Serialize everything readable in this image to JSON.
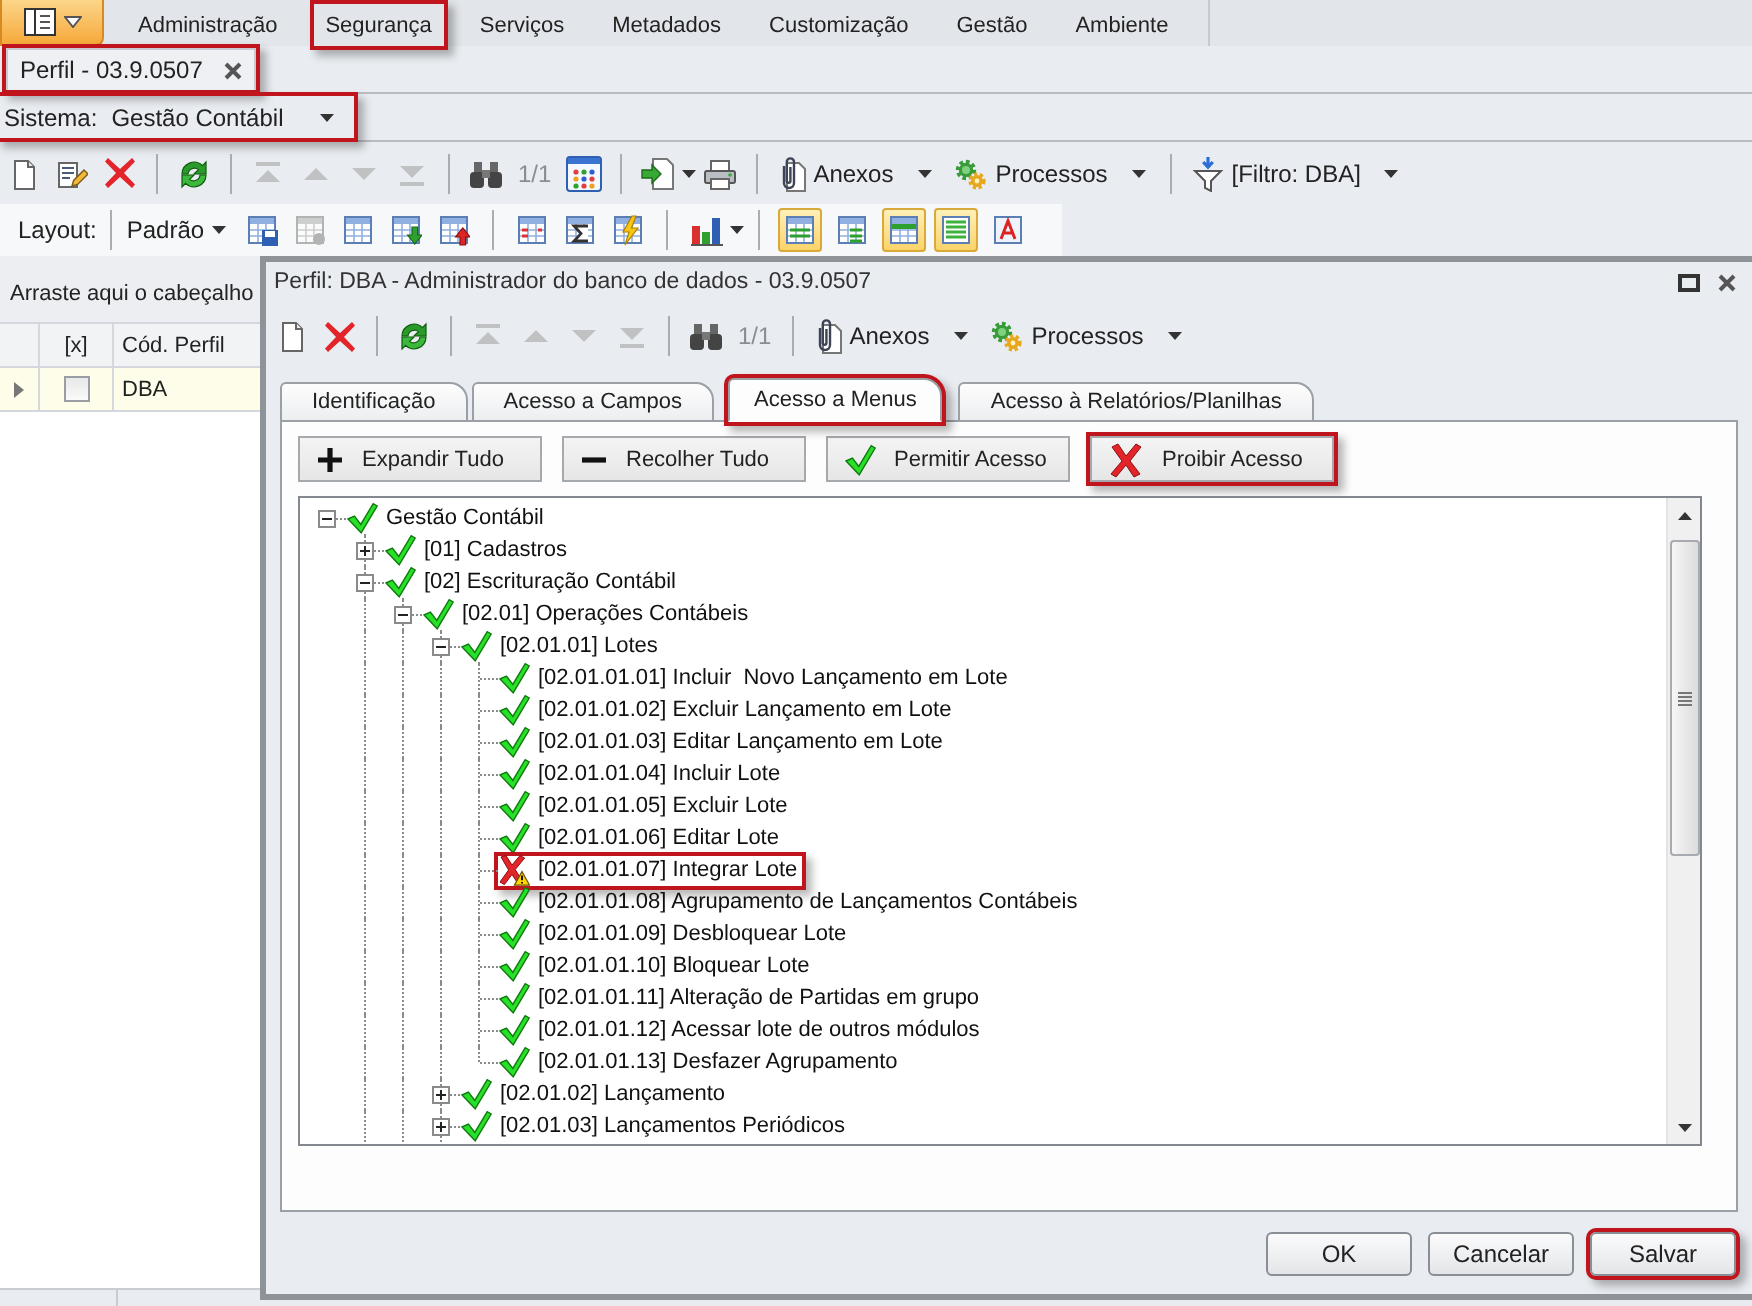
{
  "menu_bar": {
    "items": [
      {
        "label": "Administração",
        "highlighted": false
      },
      {
        "label": "Segurança",
        "highlighted": true
      },
      {
        "label": "Serviços",
        "highlighted": false
      },
      {
        "label": "Metadados",
        "highlighted": false
      },
      {
        "label": "Customização",
        "highlighted": false
      },
      {
        "label": "Gestão",
        "highlighted": false
      },
      {
        "label": "Ambiente",
        "highlighted": false
      }
    ]
  },
  "document_tabs": [
    {
      "label": "Perfil - 03.9.0507",
      "selected": true,
      "highlighted": true
    }
  ],
  "system_selector": {
    "label": "Sistema:",
    "value": "Gestão Contábil",
    "highlighted": true
  },
  "main_toolbar": {
    "navigation": [
      {
        "disabled": true
      },
      {
        "disabled": true
      },
      {
        "disabled": true
      },
      {
        "disabled": true
      }
    ],
    "record_counter": "1/1",
    "attachments": "Anexos",
    "processes": "Processos",
    "filter": "[Filtro: DBA]"
  },
  "layout_toolbar": {
    "label": "Layout:",
    "preset": "Padrão",
    "grid_buttons": [
      {
        "disabled": false
      },
      {
        "disabled": true
      },
      {
        "disabled": false
      },
      {
        "disabled": false
      },
      {
        "disabled": false
      }
    ],
    "view_buttons": [
      {
        "on": true
      },
      {
        "on": false
      },
      {
        "on": true
      },
      {
        "on": true
      },
      {
        "on": false
      }
    ]
  },
  "grid": {
    "group_panel_hint": "Arraste aqui o cabeçalho",
    "columns": [
      "[x]",
      "Cód. Perfil"
    ],
    "rows": [
      {
        "selected": true,
        "checked": false,
        "cells": [
          "",
          "DBA"
        ]
      }
    ]
  },
  "dialog": {
    "title": "Perfil: DBA - Administrador do banco de dados - 03.9.0507",
    "toolbar": {
      "navigation": [
        {
          "disabled": true
        },
        {
          "disabled": true
        },
        {
          "disabled": true
        },
        {
          "disabled": true
        }
      ],
      "record_counter": "1/1",
      "attachments": "Anexos",
      "processes": "Processos"
    },
    "tabs": [
      {
        "label": "Identificação",
        "selected": false,
        "highlighted": false
      },
      {
        "label": "Acesso a Campos",
        "selected": false,
        "highlighted": false
      },
      {
        "label": "Acesso a Menus",
        "selected": true,
        "highlighted": true
      },
      {
        "label": "Acesso à Relatórios/Planilhas",
        "selected": false,
        "highlighted": false
      }
    ],
    "actions": [
      {
        "label": "Expandir Tudo",
        "kind": "expand",
        "highlighted": false
      },
      {
        "label": "Recolher Tudo",
        "kind": "collapse",
        "highlighted": false
      },
      {
        "label": "Permitir Acesso",
        "kind": "allow",
        "highlighted": false
      },
      {
        "label": "Proibir Acesso",
        "kind": "deny",
        "highlighted": true
      }
    ],
    "tree": [
      {
        "label": "Gestão Contábil",
        "allowed": true,
        "highlighted": false,
        "expanded": true,
        "children": [
          {
            "label": "[01] Cadastros",
            "allowed": true,
            "highlighted": false,
            "expanded": false
          },
          {
            "label": "[02] Escrituração Contábil",
            "allowed": true,
            "highlighted": false,
            "expanded": true,
            "children": [
              {
                "label": "[02.01] Operações Contábeis",
                "allowed": true,
                "highlighted": false,
                "expanded": true,
                "children": [
                  {
                    "label": "[02.01.01] Lotes",
                    "allowed": true,
                    "highlighted": false,
                    "expanded": true,
                    "children": [
                      {
                        "label": "[02.01.01.01] Incluir  Novo Lançamento em Lote",
                        "allowed": true,
                        "highlighted": false
                      },
                      {
                        "label": "[02.01.01.02] Excluir Lançamento em Lote",
                        "allowed": true,
                        "highlighted": false
                      },
                      {
                        "label": "[02.01.01.03] Editar Lançamento em Lote",
                        "allowed": true,
                        "highlighted": false
                      },
                      {
                        "label": "[02.01.01.04] Incluir Lote",
                        "allowed": true,
                        "highlighted": false
                      },
                      {
                        "label": "[02.01.01.05] Excluir Lote",
                        "allowed": true,
                        "highlighted": false
                      },
                      {
                        "label": "[02.01.01.06] Editar Lote",
                        "allowed": true,
                        "highlighted": false
                      },
                      {
                        "label": "[02.01.01.07] Integrar Lote",
                        "allowed": false,
                        "highlighted": true
                      },
                      {
                        "label": "[02.01.01.08] Agrupamento de Lançamentos Contábeis",
                        "allowed": true,
                        "highlighted": false
                      },
                      {
                        "label": "[02.01.01.09] Desbloquear Lote",
                        "allowed": true,
                        "highlighted": false
                      },
                      {
                        "label": "[02.01.01.10] Bloquear Lote",
                        "allowed": true,
                        "highlighted": false
                      },
                      {
                        "label": "[02.01.01.11] Alteração de Partidas em grupo",
                        "allowed": true,
                        "highlighted": false
                      },
                      {
                        "label": "[02.01.01.12] Acessar lote de outros módulos",
                        "allowed": true,
                        "highlighted": false
                      },
                      {
                        "label": "[02.01.01.13] Desfazer Agrupamento",
                        "allowed": true,
                        "highlighted": false
                      }
                    ]
                  },
                  {
                    "label": "[02.01.02] Lançamento",
                    "allowed": true,
                    "highlighted": false,
                    "expanded": false
                  },
                  {
                    "label": "[02.01.03] Lançamentos Periódicos",
                    "allowed": true,
                    "highlighted": false,
                    "expanded": false
                  }
                ]
              }
            ]
          }
        ]
      }
    ],
    "buttons": [
      {
        "label": "OK",
        "highlighted": false
      },
      {
        "label": "Cancelar",
        "highlighted": false
      },
      {
        "label": "Salvar",
        "highlighted": true
      }
    ]
  }
}
